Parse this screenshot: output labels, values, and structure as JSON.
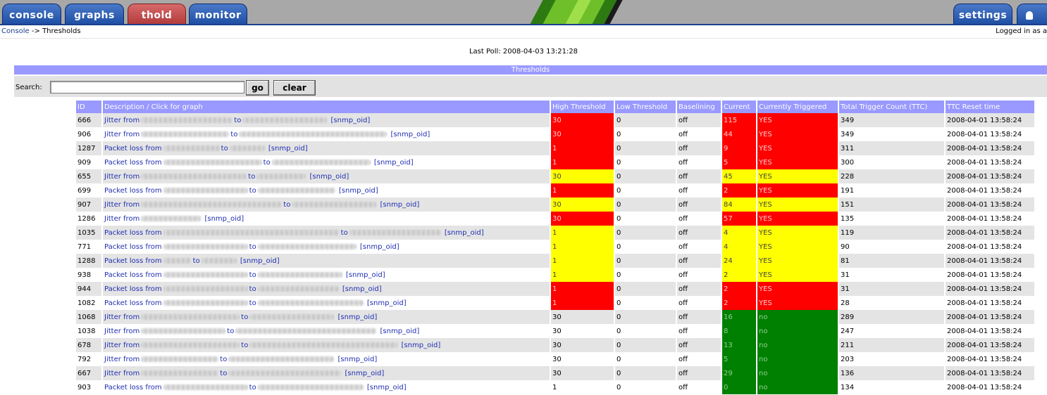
{
  "nav": {
    "tabs": [
      {
        "label": "console",
        "active": false
      },
      {
        "label": "graphs",
        "active": false
      },
      {
        "label": "thold",
        "active": true
      },
      {
        "label": "monitor",
        "active": false
      }
    ],
    "settings_label": "settings",
    "logo_colors": [
      "#6fbf2a",
      "#9fe04a",
      "#2e7a12",
      "#c8f07a"
    ]
  },
  "breadcrumb": {
    "root": "Console",
    "separator": "->",
    "current": "Thresholds"
  },
  "user": {
    "logged_in_text": "Logged in as a"
  },
  "last_poll": "Last Poll: 2008-04-03 13:21:28",
  "section_title": "Thresholds",
  "search": {
    "label": "Search:",
    "value": "",
    "go_label": "go",
    "clear_label": "clear"
  },
  "table": {
    "columns": [
      "ID",
      "Description / Click for graph",
      "High Threshold",
      "Low Threshold",
      "Baselining",
      "Current",
      "Currently Triggered",
      "Total Trigger Count (TTC)",
      "TTC Reset time"
    ],
    "rows": [
      {
        "id": "666",
        "prefix": "Jitter from",
        "mid": "to",
        "suffix": "[snmp_oid]",
        "high": "30",
        "low": "0",
        "base": "off",
        "current": "115",
        "triggered": "YES",
        "ttc": "349",
        "reset": "2008-04-01 13:58:24",
        "status": "red"
      },
      {
        "id": "906",
        "prefix": "Jitter from",
        "mid": "to",
        "suffix": "[snmp_oid]",
        "high": "30",
        "low": "0",
        "base": "off",
        "current": "44",
        "triggered": "YES",
        "ttc": "349",
        "reset": "2008-04-01 13:58:24",
        "status": "red"
      },
      {
        "id": "1287",
        "prefix": "Packet loss from",
        "mid": "to",
        "suffix": "[snmp_oid]",
        "high": "1",
        "low": "0",
        "base": "off",
        "current": "9",
        "triggered": "YES",
        "ttc": "311",
        "reset": "2008-04-01 13:58:24",
        "status": "red"
      },
      {
        "id": "909",
        "prefix": "Packet loss from",
        "mid": "to",
        "suffix": "[snmp_oid]",
        "high": "1",
        "low": "0",
        "base": "off",
        "current": "5",
        "triggered": "YES",
        "ttc": "300",
        "reset": "2008-04-01 13:58:24",
        "status": "red"
      },
      {
        "id": "655",
        "prefix": "Jitter from",
        "mid": "to",
        "suffix": "[snmp_oid]",
        "high": "30",
        "low": "0",
        "base": "off",
        "current": "45",
        "triggered": "YES",
        "ttc": "228",
        "reset": "2008-04-01 13:58:24",
        "status": "yellow"
      },
      {
        "id": "699",
        "prefix": "Packet loss from",
        "mid": "to",
        "suffix": "[snmp_oid]",
        "high": "1",
        "low": "0",
        "base": "off",
        "current": "2",
        "triggered": "YES",
        "ttc": "191",
        "reset": "2008-04-01 13:58:24",
        "status": "red"
      },
      {
        "id": "907",
        "prefix": "Jitter from",
        "mid": "to",
        "suffix": "[snmp_oid]",
        "high": "30",
        "low": "0",
        "base": "off",
        "current": "84",
        "triggered": "YES",
        "ttc": "151",
        "reset": "2008-04-01 13:58:24",
        "status": "yellow"
      },
      {
        "id": "1286",
        "prefix": "Jitter from",
        "mid": "",
        "suffix": "[snmp_oid]",
        "high": "30",
        "low": "0",
        "base": "off",
        "current": "57",
        "triggered": "YES",
        "ttc": "135",
        "reset": "2008-04-01 13:58:24",
        "status": "red"
      },
      {
        "id": "1035",
        "prefix": "Packet loss from",
        "mid": "to",
        "suffix": "[snmp_oid]",
        "high": "1",
        "low": "0",
        "base": "off",
        "current": "4",
        "triggered": "YES",
        "ttc": "119",
        "reset": "2008-04-01 13:58:24",
        "status": "yellow"
      },
      {
        "id": "771",
        "prefix": "Packet loss from",
        "mid": "to",
        "suffix": "[snmp_oid]",
        "high": "1",
        "low": "0",
        "base": "off",
        "current": "4",
        "triggered": "YES",
        "ttc": "90",
        "reset": "2008-04-01 13:58:24",
        "status": "yellow"
      },
      {
        "id": "1288",
        "prefix": "Packet loss from",
        "mid": "to",
        "suffix": "[snmp_oid]",
        "high": "1",
        "low": "0",
        "base": "off",
        "current": "24",
        "triggered": "YES",
        "ttc": "81",
        "reset": "2008-04-01 13:58:24",
        "status": "yellow"
      },
      {
        "id": "938",
        "prefix": "Packet loss from",
        "mid": "to",
        "suffix": "[snmp_oid]",
        "high": "1",
        "low": "0",
        "base": "off",
        "current": "2",
        "triggered": "YES",
        "ttc": "31",
        "reset": "2008-04-01 13:58:24",
        "status": "yellow"
      },
      {
        "id": "944",
        "prefix": "Packet loss from",
        "mid": "to",
        "suffix": "[snmp_oid]",
        "high": "1",
        "low": "0",
        "base": "off",
        "current": "2",
        "triggered": "YES",
        "ttc": "31",
        "reset": "2008-04-01 13:58:24",
        "status": "red"
      },
      {
        "id": "1082",
        "prefix": "Packet loss from",
        "mid": "to",
        "suffix": "[snmp_oid]",
        "high": "1",
        "low": "0",
        "base": "off",
        "current": "2",
        "triggered": "YES",
        "ttc": "28",
        "reset": "2008-04-01 13:58:24",
        "status": "red"
      },
      {
        "id": "1068",
        "prefix": "Jitter from",
        "mid": "to",
        "suffix": "[snmp_oid]",
        "high": "30",
        "low": "0",
        "base": "off",
        "current": "16",
        "triggered": "no",
        "ttc": "289",
        "reset": "2008-04-01 13:58:24",
        "status": "green"
      },
      {
        "id": "1038",
        "prefix": "Jitter from",
        "mid": "to",
        "suffix": "[snmp_oid]",
        "high": "30",
        "low": "0",
        "base": "off",
        "current": "8",
        "triggered": "no",
        "ttc": "247",
        "reset": "2008-04-01 13:58:24",
        "status": "green"
      },
      {
        "id": "678",
        "prefix": "Jitter from",
        "mid": "to",
        "suffix": "[snmp_oid]",
        "high": "30",
        "low": "0",
        "base": "off",
        "current": "13",
        "triggered": "no",
        "ttc": "211",
        "reset": "2008-04-01 13:58:24",
        "status": "green"
      },
      {
        "id": "792",
        "prefix": "Jitter from",
        "mid": "to",
        "suffix": "[snmp_oid]",
        "high": "30",
        "low": "0",
        "base": "off",
        "current": "5",
        "triggered": "no",
        "ttc": "203",
        "reset": "2008-04-01 13:58:24",
        "status": "green"
      },
      {
        "id": "667",
        "prefix": "Jitter from",
        "mid": "to",
        "suffix": "[snmp_oid]",
        "high": "30",
        "low": "0",
        "base": "off",
        "current": "29",
        "triggered": "no",
        "ttc": "136",
        "reset": "2008-04-01 13:58:24",
        "status": "green"
      },
      {
        "id": "903",
        "prefix": "Packet loss from",
        "mid": "to",
        "suffix": "[snmp_oid]",
        "high": "1",
        "low": "0",
        "base": "off",
        "current": "0",
        "triggered": "no",
        "ttc": "134",
        "reset": "2008-04-01 13:58:24",
        "status": "green"
      }
    ]
  }
}
